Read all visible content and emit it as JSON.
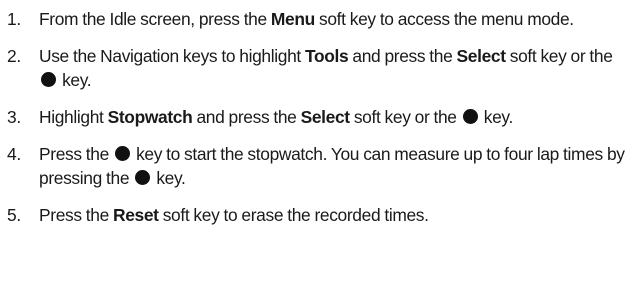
{
  "steps": [
    {
      "number": "1.",
      "segments": [
        {
          "text": "From the Idle screen, press the ",
          "bold": false
        },
        {
          "text": "Menu",
          "bold": true
        },
        {
          "text": " soft key to access the menu mode.",
          "bold": false
        }
      ]
    },
    {
      "number": "2.",
      "segments": [
        {
          "text": "Use the Navigation keys to highlight ",
          "bold": false
        },
        {
          "text": "Tools",
          "bold": true
        },
        {
          "text": " and press the ",
          "bold": false
        },
        {
          "text": "Select",
          "bold": true
        },
        {
          "text": " soft key or the ",
          "bold": false
        },
        {
          "icon": "center-key-dot-icon"
        },
        {
          "text": " key.",
          "bold": false
        }
      ]
    },
    {
      "number": "3.",
      "segments": [
        {
          "text": "Highlight ",
          "bold": false
        },
        {
          "text": "Stopwatch",
          "bold": true
        },
        {
          "text": " and press the ",
          "bold": false
        },
        {
          "text": "Select",
          "bold": true
        },
        {
          "text": " soft key or the ",
          "bold": false
        },
        {
          "icon": "center-key-dot-icon"
        },
        {
          "text": " key.",
          "bold": false
        }
      ]
    },
    {
      "number": "4.",
      "segments": [
        {
          "text": "Press the ",
          "bold": false
        },
        {
          "icon": "center-key-dot-icon"
        },
        {
          "text": " key to start the stopwatch. You can measure up to four lap times by pressing the ",
          "bold": false
        },
        {
          "icon": "center-key-dot-icon"
        },
        {
          "text": " key.",
          "bold": false
        }
      ]
    },
    {
      "number": "5.",
      "segments": [
        {
          "text": " Press the ",
          "bold": false
        },
        {
          "text": "Reset",
          "bold": true
        },
        {
          "text": " soft key to erase the recorded times.",
          "bold": false
        }
      ]
    }
  ]
}
